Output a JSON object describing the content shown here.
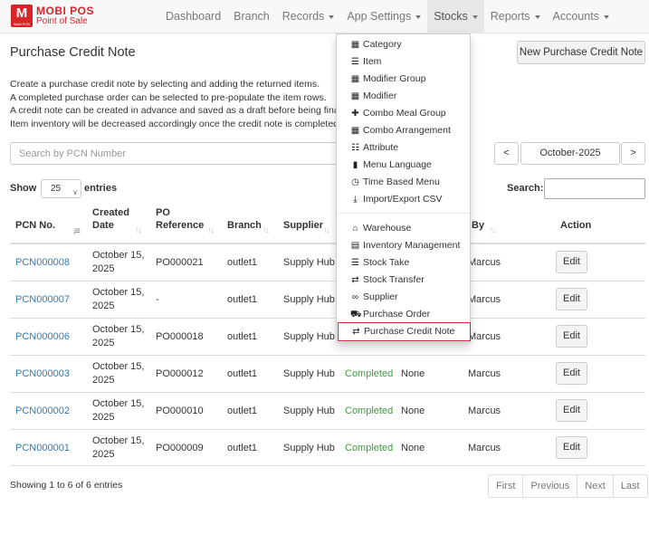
{
  "brand": {
    "logo_letter": "M",
    "logo_sub": "Mobi POS",
    "name": "MOBI POS",
    "tagline": "Point of Sale"
  },
  "nav": [
    {
      "label": "Dashboard",
      "caret": false
    },
    {
      "label": "Branch",
      "caret": false
    },
    {
      "label": "Records",
      "caret": true
    },
    {
      "label": "App Settings",
      "caret": true
    },
    {
      "label": "Stocks",
      "caret": true,
      "active": true
    },
    {
      "label": "Reports",
      "caret": true
    },
    {
      "label": "Accounts",
      "caret": true
    }
  ],
  "page": {
    "title": "Purchase Credit Note",
    "new_button": "New Purchase Credit Note",
    "description": [
      "Create a purchase credit note by selecting and adding the returned items.",
      "A completed purchase order can be selected to pre-populate the item rows.",
      "A credit note can be created in advance and saved as a draft before being finalized.",
      "Item inventory will be decreased accordingly once the credit note is completed."
    ]
  },
  "filters": {
    "search_placeholder": "Search by PCN Number",
    "prev": "<",
    "month": "October-2025",
    "next": ">",
    "show_label": "Show",
    "page_size": "25",
    "entries_label": "entries",
    "search_label": "Search:"
  },
  "table": {
    "headers": [
      {
        "l1": "PCN No.",
        "l2": ""
      },
      {
        "l1": "Created",
        "l2": "Date"
      },
      {
        "l1": "PO",
        "l2": "Reference"
      },
      {
        "l1": "Branch",
        "l2": ""
      },
      {
        "l1": "Supplier",
        "l2": ""
      },
      {
        "l1": "By",
        "l2": ""
      },
      {
        "l1": "Action",
        "l2": ""
      }
    ],
    "rows": [
      {
        "pcn": "PCN000008",
        "date1": "October 15,",
        "date2": "2025",
        "po": "PO000021",
        "branch": "outlet1",
        "supplier": "Supply Hub",
        "status": "",
        "ref": "",
        "by": "Marcus",
        "action": "Edit"
      },
      {
        "pcn": "PCN000007",
        "date1": "October 15,",
        "date2": "2025",
        "po": "-",
        "branch": "outlet1",
        "supplier": "Supply Hub",
        "status": "",
        "ref": "",
        "by": "Marcus",
        "action": "Edit"
      },
      {
        "pcn": "PCN000006",
        "date1": "October 15,",
        "date2": "2025",
        "po": "PO000018",
        "branch": "outlet1",
        "supplier": "Supply Hub",
        "status": "",
        "ref": "",
        "by": "Marcus",
        "action": "Edit"
      },
      {
        "pcn": "PCN000003",
        "date1": "October 15,",
        "date2": "2025",
        "po": "PO000012",
        "branch": "outlet1",
        "supplier": "Supply Hub",
        "status": "Completed",
        "ref": "None",
        "by": "Marcus",
        "action": "Edit"
      },
      {
        "pcn": "PCN000002",
        "date1": "October 15,",
        "date2": "2025",
        "po": "PO000010",
        "branch": "outlet1",
        "supplier": "Supply Hub",
        "status": "Completed",
        "ref": "None",
        "by": "Marcus",
        "action": "Edit"
      },
      {
        "pcn": "PCN000001",
        "date1": "October 15,",
        "date2": "2025",
        "po": "PO000009",
        "branch": "outlet1",
        "supplier": "Supply Hub",
        "status": "Completed",
        "ref": "None",
        "by": "Marcus",
        "action": "Edit"
      }
    ]
  },
  "footer": {
    "showing": "Showing 1 to 6 of 6 entries",
    "pager": [
      "First",
      "Previous",
      "Next",
      "Last"
    ]
  },
  "dropdown": {
    "group1": [
      {
        "label": "Category",
        "icon": "grid-icon"
      },
      {
        "label": "Item",
        "icon": "list-icon"
      },
      {
        "label": "Modifier Group",
        "icon": "grid-icon"
      },
      {
        "label": "Modifier",
        "icon": "grid-icon"
      },
      {
        "label": "Combo Meal Group",
        "icon": "cutlery-icon"
      },
      {
        "label": "Combo Arrangement",
        "icon": "grid-icon"
      },
      {
        "label": "Attribute",
        "icon": "th-icon"
      },
      {
        "label": "Menu Language",
        "icon": "file-icon"
      },
      {
        "label": "Time Based Menu",
        "icon": "clock-icon"
      },
      {
        "label": "Import/Export CSV",
        "icon": "import-icon"
      }
    ],
    "group2": [
      {
        "label": "Warehouse",
        "icon": "home-icon"
      },
      {
        "label": "Inventory Management",
        "icon": "tasks-icon"
      },
      {
        "label": "Stock Take",
        "icon": "list-icon"
      },
      {
        "label": "Stock Transfer",
        "icon": "transfer-icon"
      },
      {
        "label": "Supplier",
        "icon": "link-icon"
      },
      {
        "label": "Purchase Order",
        "icon": "cart-icon"
      },
      {
        "label": "Purchase Credit Note",
        "icon": "transfer-icon",
        "highlight": true
      }
    ]
  },
  "colors": {
    "brand": "#d9252a",
    "link": "#337ab7",
    "completed": "#3c9f3c",
    "highlight_border": "#d9252a"
  }
}
